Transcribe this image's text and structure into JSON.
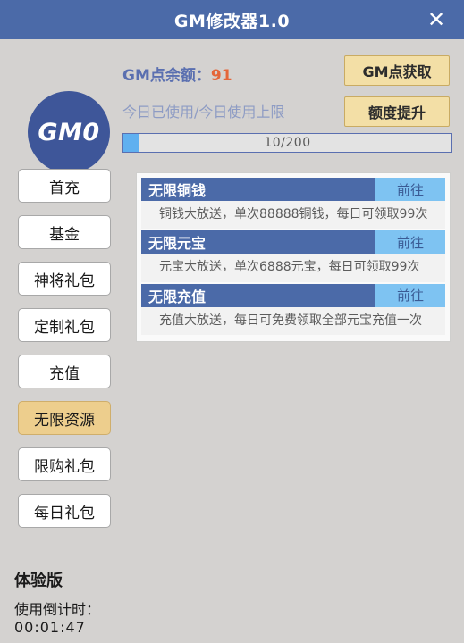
{
  "titlebar": {
    "title": "GM修改器1.0",
    "close_icon": "close-icon",
    "close_glyph": "✕"
  },
  "header": {
    "avatar_label": "GM0",
    "balance_label": "GM点余额：",
    "balance_value": "91",
    "usage_label": "今日已使用/今日使用上限",
    "buttons": [
      {
        "label": "GM点获取"
      },
      {
        "label": "额度提升"
      }
    ],
    "progress": {
      "text": "10/200",
      "used": 10,
      "limit": 200,
      "fill_color": "#5fb0f0"
    }
  },
  "sidebar": {
    "items": [
      {
        "label": "首充",
        "active": false
      },
      {
        "label": "基金",
        "active": false
      },
      {
        "label": "神将礼包",
        "active": false
      },
      {
        "label": "定制礼包",
        "active": false
      },
      {
        "label": "充值",
        "active": false
      },
      {
        "label": "无限资源",
        "active": true
      },
      {
        "label": "限购礼包",
        "active": false
      },
      {
        "label": "每日礼包",
        "active": false
      }
    ]
  },
  "panel": {
    "items": [
      {
        "title": "无限铜钱",
        "action_label": "前往",
        "desc": "铜钱大放送，单次88888铜钱，每日可领取99次"
      },
      {
        "title": "无限元宝",
        "action_label": "前往",
        "desc": "元宝大放送，单次6888元宝，每日可领取99次"
      },
      {
        "title": "无限充值",
        "action_label": "前往",
        "desc": "充值大放送，每日可免费领取全部元宝充值一次"
      }
    ]
  },
  "footer": {
    "edition": "体验版",
    "countdown_label": "使用倒计时：",
    "countdown_value": "00:01:47"
  },
  "colors": {
    "titlebar": "#4b6aa8",
    "accent_blue": "#4b6aa8",
    "light_blue": "#7ec3f2",
    "tan": "#f3dfa6",
    "tan_active": "#edce8d",
    "orange": "#e4663a",
    "body_bg": "#d4d2d0"
  }
}
